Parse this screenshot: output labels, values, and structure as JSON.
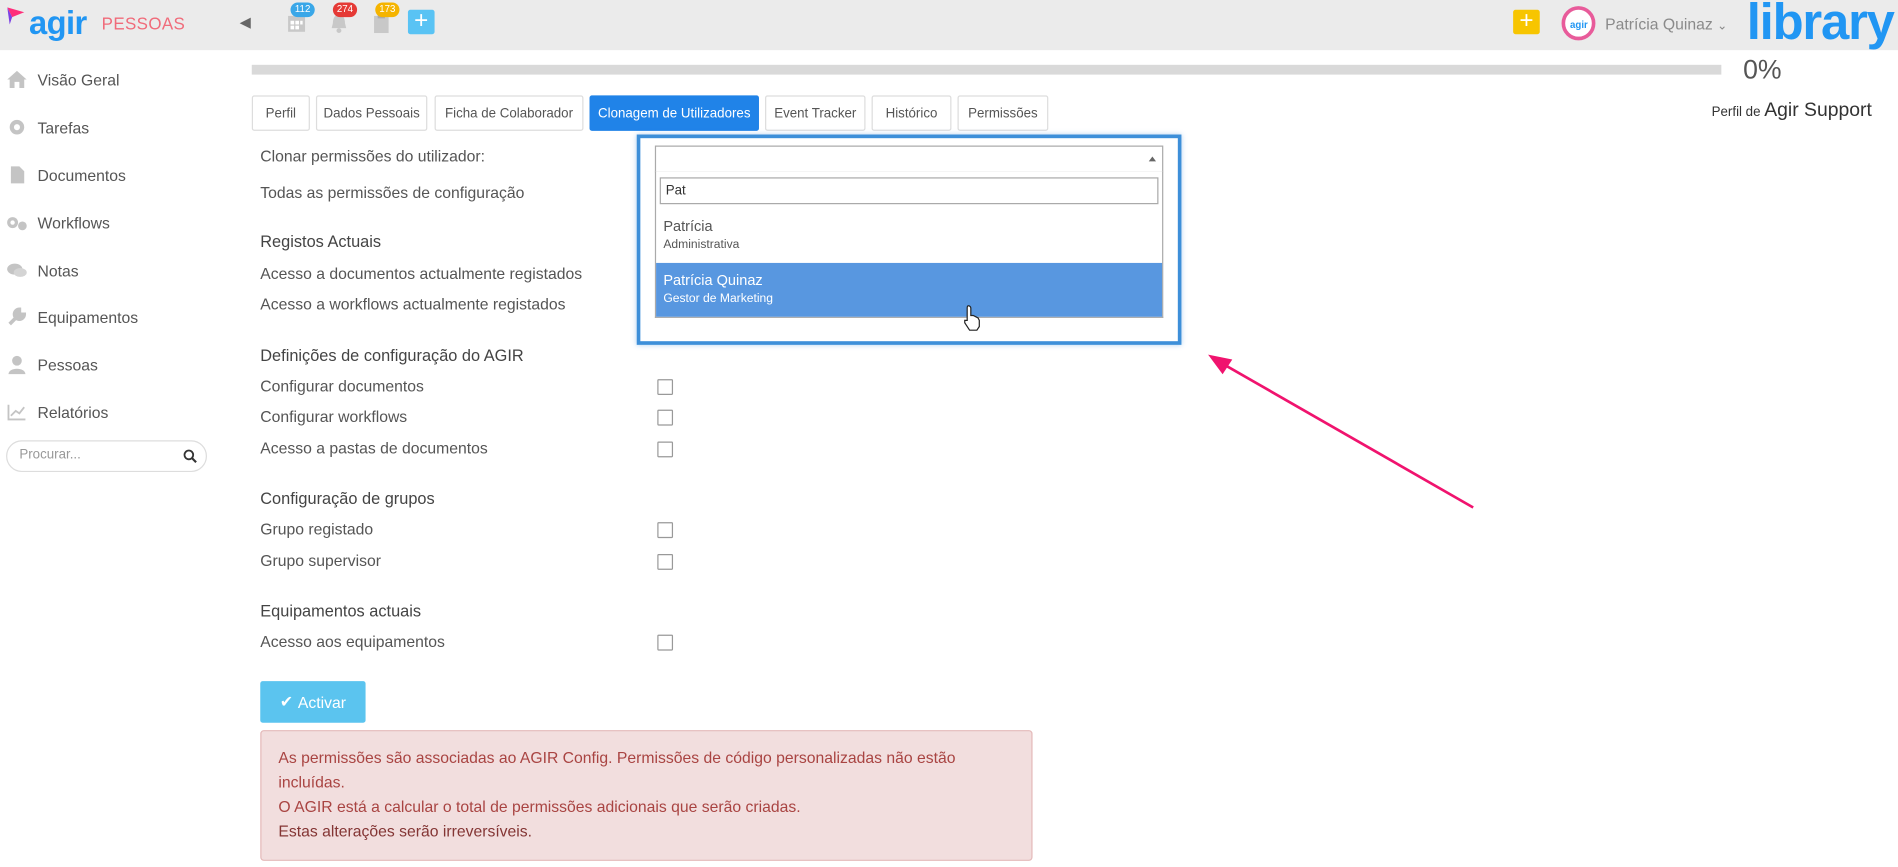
{
  "header": {
    "logo_text": "agir",
    "module": "PESSOAS",
    "badges": [
      {
        "icon": "calendar-icon",
        "count": "112",
        "color": "#3aa7e8"
      },
      {
        "icon": "bell-icon",
        "count": "274",
        "color": "#e53935"
      },
      {
        "icon": "clipboard-icon",
        "count": "173",
        "color": "#f5b400"
      }
    ],
    "user_name": "Patrícia Quinaz",
    "brand": "library",
    "avatar_text": "agir"
  },
  "sidebar": {
    "items": [
      {
        "label": "Visão Geral",
        "icon": "home-icon"
      },
      {
        "label": "Tarefas",
        "icon": "gear-icon"
      },
      {
        "label": "Documentos",
        "icon": "document-icon"
      },
      {
        "label": "Workflows",
        "icon": "gears-icon"
      },
      {
        "label": "Notas",
        "icon": "chat-icon"
      },
      {
        "label": "Equipamentos",
        "icon": "wrench-icon"
      },
      {
        "label": "Pessoas",
        "icon": "person-icon"
      },
      {
        "label": "Relatórios",
        "icon": "chart-icon"
      }
    ],
    "search_placeholder": "Procurar..."
  },
  "progress": {
    "value": 0,
    "label": "0%"
  },
  "profile": {
    "prefix": "Perfil de",
    "name": "Agir Support"
  },
  "tabs": [
    {
      "label": "Perfil"
    },
    {
      "label": "Dados Pessoais"
    },
    {
      "label": "Ficha de Colaborador"
    },
    {
      "label": "Clonagem de Utilizadores",
      "active": true
    },
    {
      "label": "Event Tracker"
    },
    {
      "label": "Histórico"
    },
    {
      "label": "Permissões"
    }
  ],
  "form": {
    "clone_label": "Clonar permissões do utilizador:",
    "all_config_label": "Todas as permissões de configuração",
    "sections": {
      "current_records": "Registos Actuais",
      "agir_config": "Definições de configuração do AGIR",
      "groups": "Configuração de grupos",
      "equipment": "Equipamentos actuais"
    },
    "rows": {
      "docs_access": "Acesso a documentos actualmente registados",
      "workflows_access": "Acesso a workflows actualmente registados",
      "config_docs": "Configurar documentos",
      "config_workflows": "Configurar workflows",
      "folders_access": "Acesso a pastas de documentos",
      "registered_group": "Grupo registado",
      "supervisor_group": "Grupo supervisor",
      "equipment_access": "Acesso aos equipamentos"
    }
  },
  "dropdown": {
    "selected": "",
    "search_value": "Pat",
    "options": [
      {
        "name": "Patrícia",
        "role": "Administrativa",
        "highlighted": false
      },
      {
        "name": "Patrícia Quinaz",
        "role": "Gestor de Marketing",
        "highlighted": true
      }
    ]
  },
  "activate_button": "Activar",
  "alert": {
    "line1": "As permissões são associadas ao AGIR Config. Permissões de código personalizadas não estão incluídas.",
    "line2": "O AGIR está a calcular o total de permissões adicionais que serão criadas.",
    "line3": "Estas alterações serão irreversíveis."
  },
  "colors": {
    "accent": "#2196f3",
    "tab_active": "#2083e8",
    "highlight": "#5897e0",
    "arrow": "#f0136e",
    "alert_bg": "#f2dede"
  }
}
